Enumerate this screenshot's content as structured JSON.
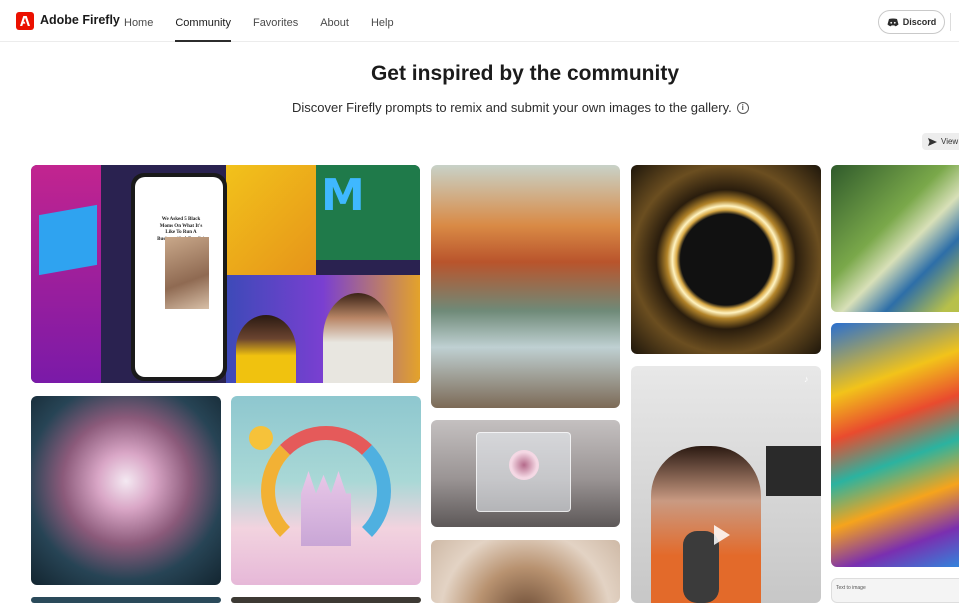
{
  "header": {
    "brand": "Adobe Firefly",
    "nav": [
      "Home",
      "Community",
      "Favorites",
      "About",
      "Help"
    ],
    "active_nav": "Community",
    "discord_label": "Discord"
  },
  "hero": {
    "title": "Get inspired by the community",
    "subtitle": "Discover Firefly prompts to remix and submit your own images to the gallery."
  },
  "toolbar": {
    "view_label": "View"
  },
  "tiles": {
    "t1": {
      "phone_headline": "We Asked 5 Black Moms On What It's Like To Run A Business (& A Family)"
    },
    "t14": {
      "caption": "Text to image"
    }
  },
  "icons": {
    "logo": "adobe-logo-icon",
    "discord": "discord-icon",
    "info": "info-icon",
    "view": "send-icon",
    "play": "play-icon",
    "tiktok": "tiktok-icon"
  },
  "colors": {
    "brand_red": "#eb1000"
  }
}
